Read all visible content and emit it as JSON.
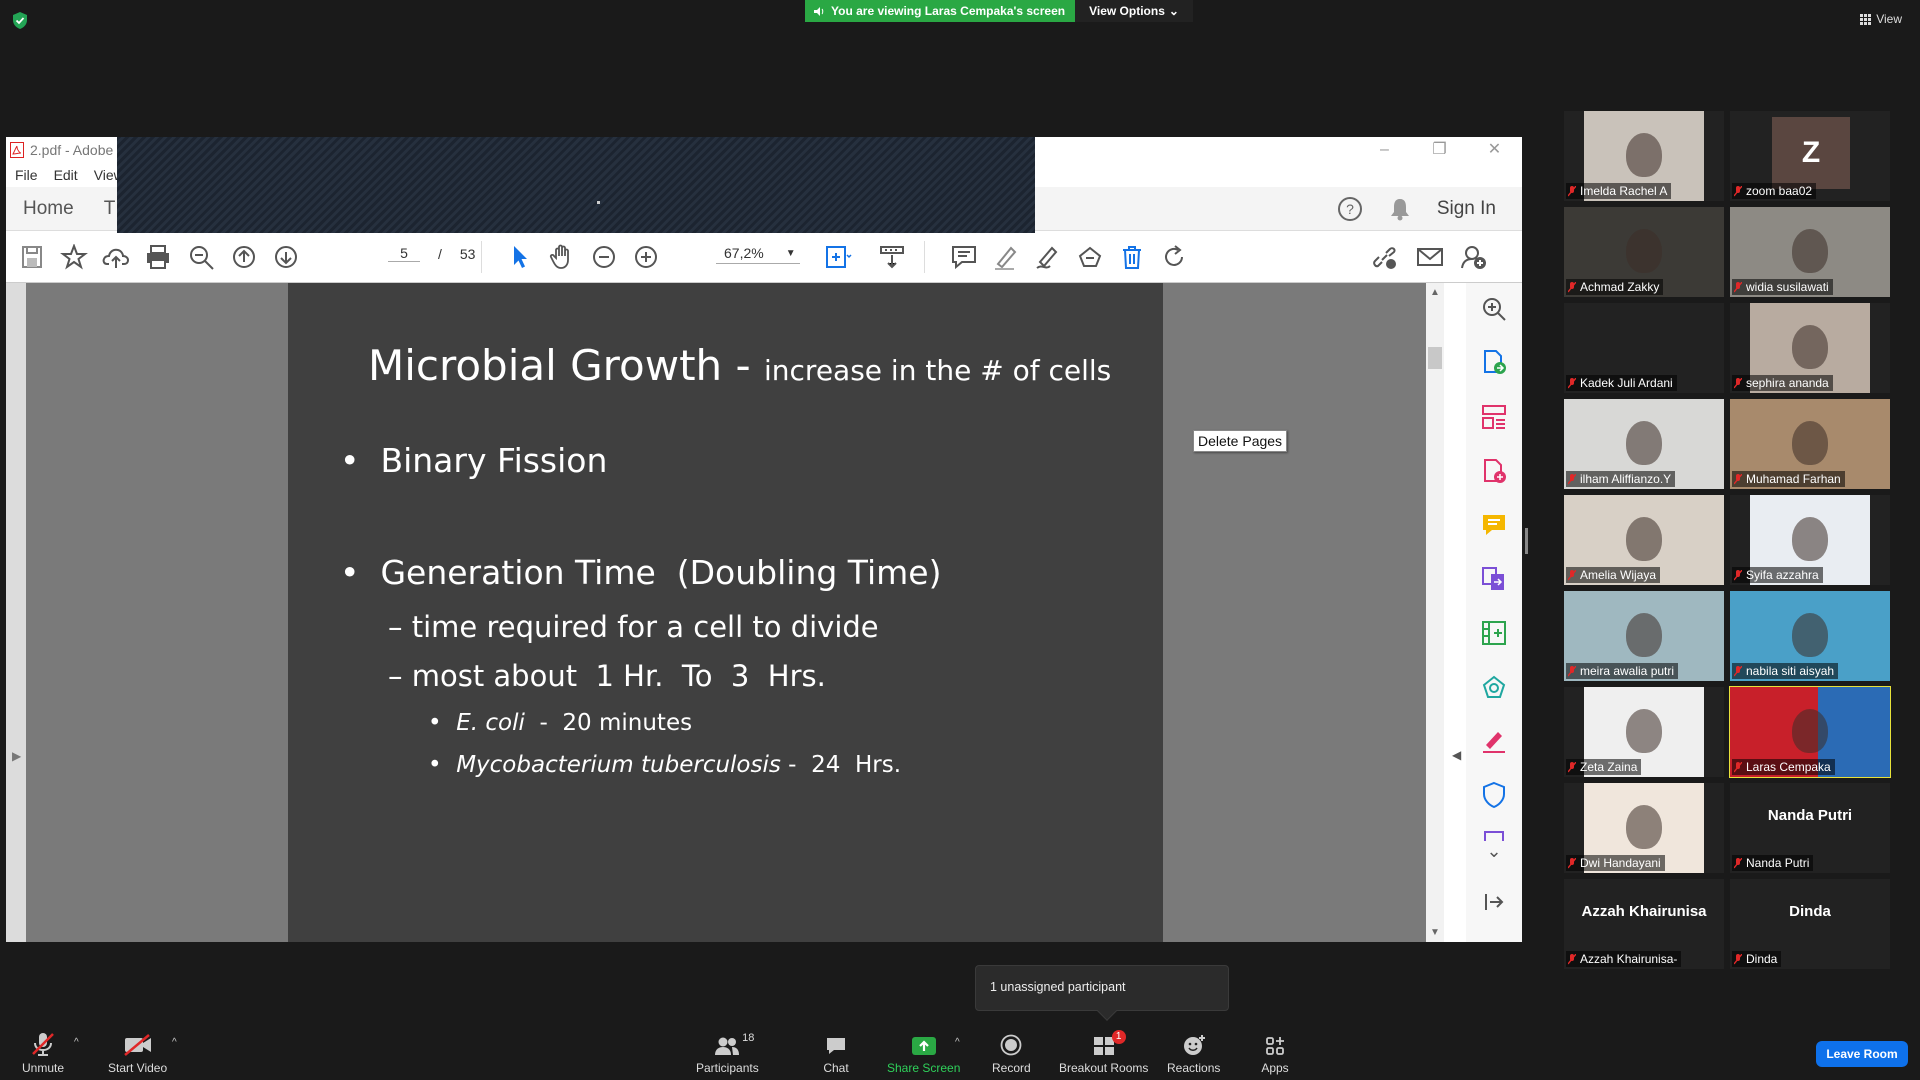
{
  "banner": {
    "message": "You are viewing Laras Cempaka's screen",
    "options_label": "View Options"
  },
  "view_label": "View",
  "acrobat": {
    "title": "2.pdf - Adobe",
    "menu": [
      "File",
      "Edit",
      "View"
    ],
    "nav": {
      "home": "Home",
      "tools": "T",
      "sign_in": "Sign In"
    },
    "page": {
      "current": "5",
      "total": "53"
    },
    "zoom": "67,2%",
    "tooltip": "Delete Pages"
  },
  "slide": {
    "title": "Microbial Growth",
    "title_dash": " - ",
    "subtitle": "increase in the # of cells",
    "bullet1": "Binary Fission",
    "bullet2": "Generation Time  (Doubling Time)",
    "dash1": "time required for a cell to divide",
    "dash2": "most about  1 Hr.  To  3  Hrs.",
    "sub1_italic": "E. coli",
    "sub1_rest": "  -  20 minutes",
    "sub2_italic": "Mycobacterium tuberculosis",
    "sub2_rest": " -  24  Hrs."
  },
  "participants": [
    {
      "name": "Imelda Rachel A",
      "type": "photo"
    },
    {
      "name": "zoom baa02",
      "type": "avatar",
      "initial": "Z"
    },
    {
      "name": "Achmad Zakky",
      "type": "photo"
    },
    {
      "name": "widia susilawati",
      "type": "photo"
    },
    {
      "name": "Kadek Juli Ardani",
      "type": "blank"
    },
    {
      "name": "sephira ananda",
      "type": "photo"
    },
    {
      "name": "ilham Aliffianzo.Y",
      "type": "photo"
    },
    {
      "name": "Muhamad Farhan",
      "type": "photo"
    },
    {
      "name": "Amelia Wijaya",
      "type": "photo"
    },
    {
      "name": "Syifa azzahra",
      "type": "photo"
    },
    {
      "name": "meira awalia putri",
      "type": "photo"
    },
    {
      "name": "nabila siti aisyah",
      "type": "photo"
    },
    {
      "name": "Zeta Zaina",
      "type": "photo"
    },
    {
      "name": "Laras Cempaka",
      "type": "photo",
      "active": true
    },
    {
      "name": "Dwi Handayani",
      "type": "photo"
    },
    {
      "name": "Nanda Putri",
      "type": "text",
      "display": "Nanda Putri"
    },
    {
      "name": "Azzah Khairunisa-",
      "type": "text",
      "display": "Azzah Khairunisa"
    },
    {
      "name": "Dinda",
      "type": "text",
      "display": "Dinda"
    }
  ],
  "unassigned": "1 unassigned participant",
  "controls": {
    "unmute": "Unmute",
    "start_video": "Start Video",
    "participants": "Participants",
    "participants_count": "18",
    "chat": "Chat",
    "share_screen": "Share Screen",
    "record": "Record",
    "breakout": "Breakout Rooms",
    "breakout_badge": "1",
    "reactions": "Reactions",
    "apps": "Apps",
    "leave": "Leave Room"
  },
  "colors": {
    "share_green": "#2aa844",
    "active_tile": "#e8e23a",
    "leave_blue": "#0e71eb",
    "mute_red": "#e02828"
  }
}
